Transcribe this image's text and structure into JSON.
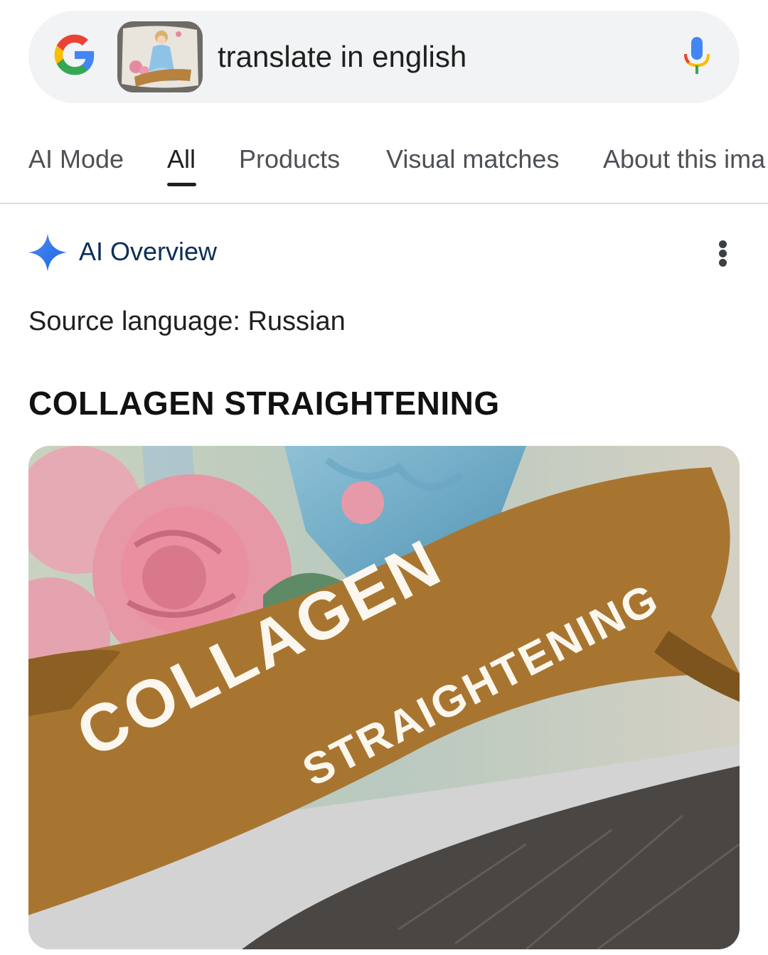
{
  "search": {
    "query": "translate in english",
    "logo_icon": "google-g-icon",
    "mic_icon": "microphone-icon",
    "thumbnail_icon": "cinderella-sticker-thumbnail"
  },
  "tabs": [
    {
      "label": "AI Mode"
    },
    {
      "label": "All",
      "active": true
    },
    {
      "label": "Products"
    },
    {
      "label": "Visual matches"
    },
    {
      "label": "About this ima"
    }
  ],
  "ai_overview": {
    "title": "AI Overview",
    "icon": "sparkle-icon",
    "menu_icon": "more-vert-icon",
    "source_language": "Source language: Russian",
    "heading": "COLLAGEN STRAIGHTENING",
    "image_text_line1": "COLLAGEN",
    "image_text_line2": "STRAIGHTENING"
  },
  "colors": {
    "accent": "#4285f4",
    "ai_title": "#0b2d59",
    "search_bg": "#f1f3f4",
    "ribbon": "#a87530"
  }
}
